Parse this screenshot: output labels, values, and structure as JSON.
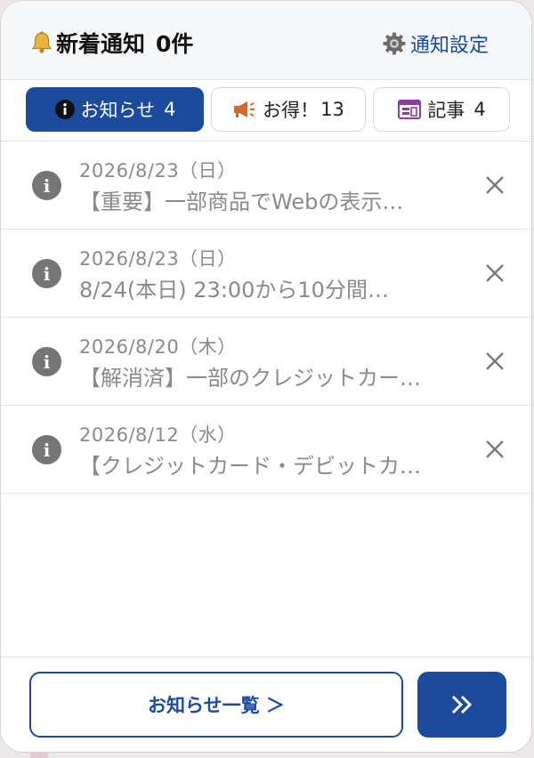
{
  "header": {
    "title": "新着通知",
    "count_text": "0件",
    "settings_label": "通知設定"
  },
  "tabs": [
    {
      "label": "お知らせ",
      "count": "4",
      "icon": "info-icon",
      "active": true
    },
    {
      "label": "お得！",
      "count": "13",
      "icon": "megaphone-icon",
      "active": false
    },
    {
      "label": "記事",
      "count": "4",
      "icon": "calendar-icon",
      "active": false
    }
  ],
  "notifications": [
    {
      "date": "2026/8/23（日）",
      "title": "【重要】一部商品でWebの表示…"
    },
    {
      "date": "2026/8/23（日）",
      "title": "8/24(本日) 23:00から10分間…"
    },
    {
      "date": "2026/8/20（木）",
      "title": "【解消済】一部のクレジットカー…"
    },
    {
      "date": "2026/8/12（水）",
      "title": "【クレジットカード・デビットカ…"
    }
  ],
  "footer": {
    "list_button_label": "お知らせ一覧 ＞"
  },
  "colors": {
    "accent": "#1c4a9c",
    "muted_text": "#8a8a8a",
    "icon_gray": "#757575"
  }
}
